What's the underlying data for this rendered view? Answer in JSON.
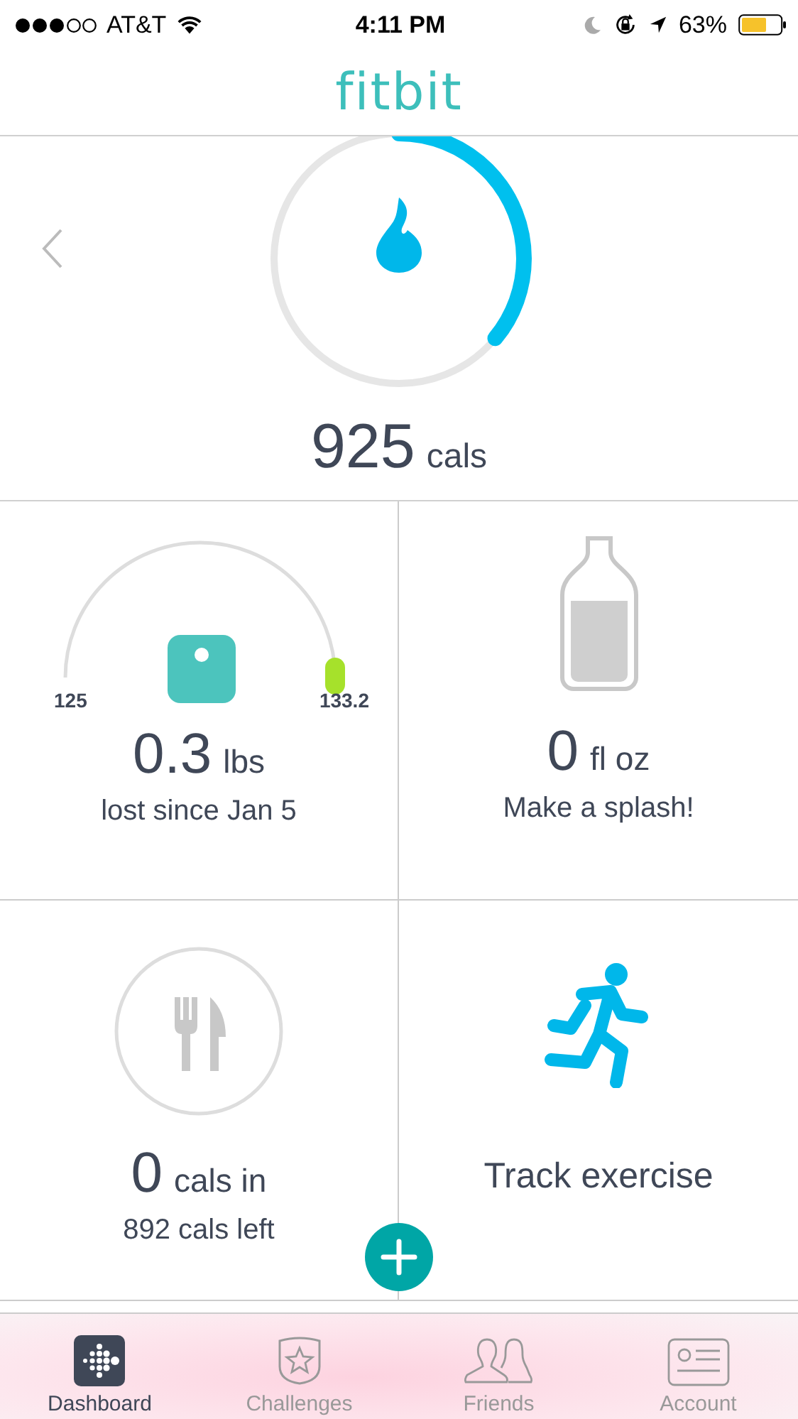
{
  "status_bar": {
    "carrier": "AT&T",
    "time": "4:11 PM",
    "battery": "63%"
  },
  "header": {
    "logo": "fitbit"
  },
  "calories": {
    "value": "925",
    "unit": "cals",
    "level": 0.36
  },
  "tiles": [
    {
      "kind": "weight",
      "value": "0.3",
      "unit": "lbs",
      "caption": "lost since Jan 5",
      "start": "125",
      "goal": "133.2"
    },
    {
      "kind": "water",
      "value": "0",
      "unit": "fl oz",
      "caption": "Make a splash!"
    },
    {
      "kind": "food",
      "value": "0",
      "unit": "cals in",
      "caption": "892 cals left"
    },
    {
      "kind": "exercise",
      "label": "Track exercise"
    }
  ],
  "tabs": [
    {
      "kind": "dashboard",
      "label": "Dashboard",
      "selected": true
    },
    {
      "kind": "challenges",
      "label": "Challenges",
      "selected": false
    },
    {
      "kind": "friends",
      "label": "Friends",
      "selected": false
    },
    {
      "kind": "account",
      "label": "Account",
      "selected": false
    }
  ]
}
